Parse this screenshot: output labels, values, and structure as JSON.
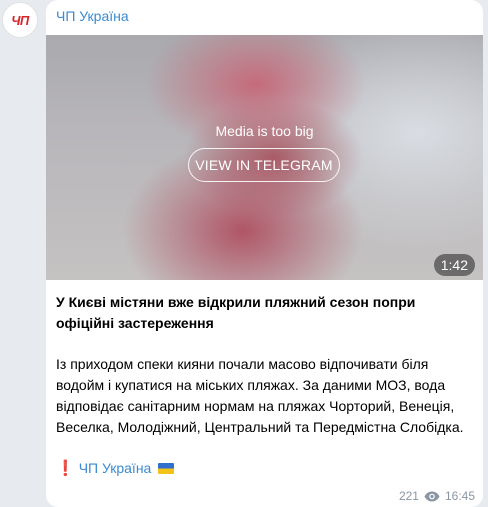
{
  "channel": {
    "avatar_text": "ЧП",
    "name": "ЧП Україна"
  },
  "media": {
    "notice": "Media is too big",
    "button_label": "VIEW IN TELEGRAM",
    "duration": "1:42"
  },
  "post": {
    "title": "У Києві містяни вже відкрили пляжний сезон попри офіційні застереження",
    "body": "Із приходом спеки кияни почали масово відпочивати біля водойм і купатися на міських пляжах. За даними МОЗ, вода відповідає санітарним нормам на пляжах Чорторий, Венеція, Веселка, Молодіжний, Центральний та Передмістна Слобідка.",
    "signature_mark": "❗",
    "signature_text": "ЧП Україна"
  },
  "meta": {
    "views": "221",
    "time": "16:45"
  },
  "colors": {
    "background": "#e7ebf0",
    "link": "#3a8ad0",
    "avatar_accent": "#d9252a"
  }
}
